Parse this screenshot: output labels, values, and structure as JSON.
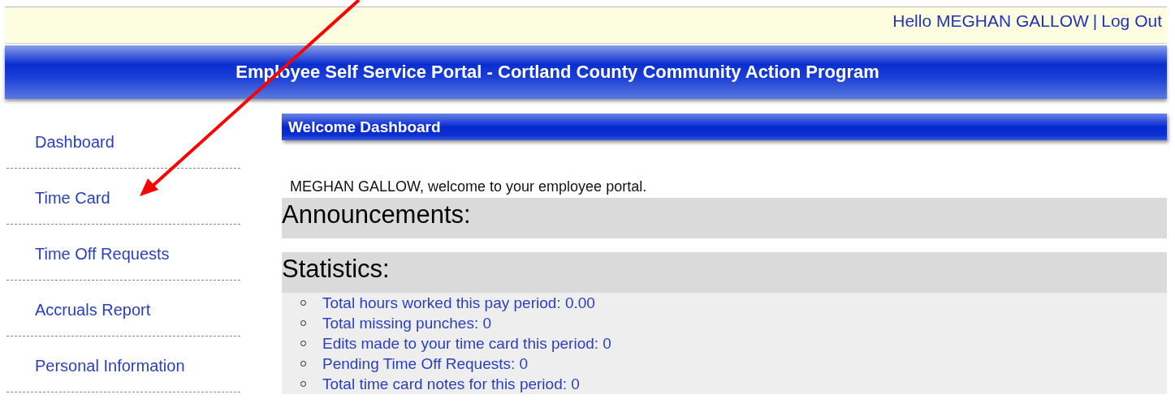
{
  "user_bar": {
    "greeting": "Hello MEGHAN GALLOW",
    "separator": "|",
    "logout": "Log Out"
  },
  "header": {
    "title": "Employee Self Service Portal - Cortland County Community Action Program"
  },
  "sidebar": {
    "items": [
      {
        "label": "Dashboard"
      },
      {
        "label": "Time Card"
      },
      {
        "label": "Time Off Requests"
      },
      {
        "label": "Accruals Report"
      },
      {
        "label": "Personal Information"
      }
    ]
  },
  "main": {
    "title": "Welcome Dashboard",
    "welcome": "MEGHAN GALLOW, welcome to your employee portal.",
    "sections": [
      {
        "kind": "heading",
        "title": "Announcements:"
      },
      {
        "kind": "list",
        "title": "Statistics:",
        "items": [
          "Total hours worked this pay period: 0.00",
          "Total missing punches: 0",
          "Edits made to your time card this period: 0",
          "Pending Time Off Requests: 0",
          "Total time card notes for this period: 0"
        ]
      }
    ]
  },
  "annotation": {
    "kind": "arrow"
  }
}
